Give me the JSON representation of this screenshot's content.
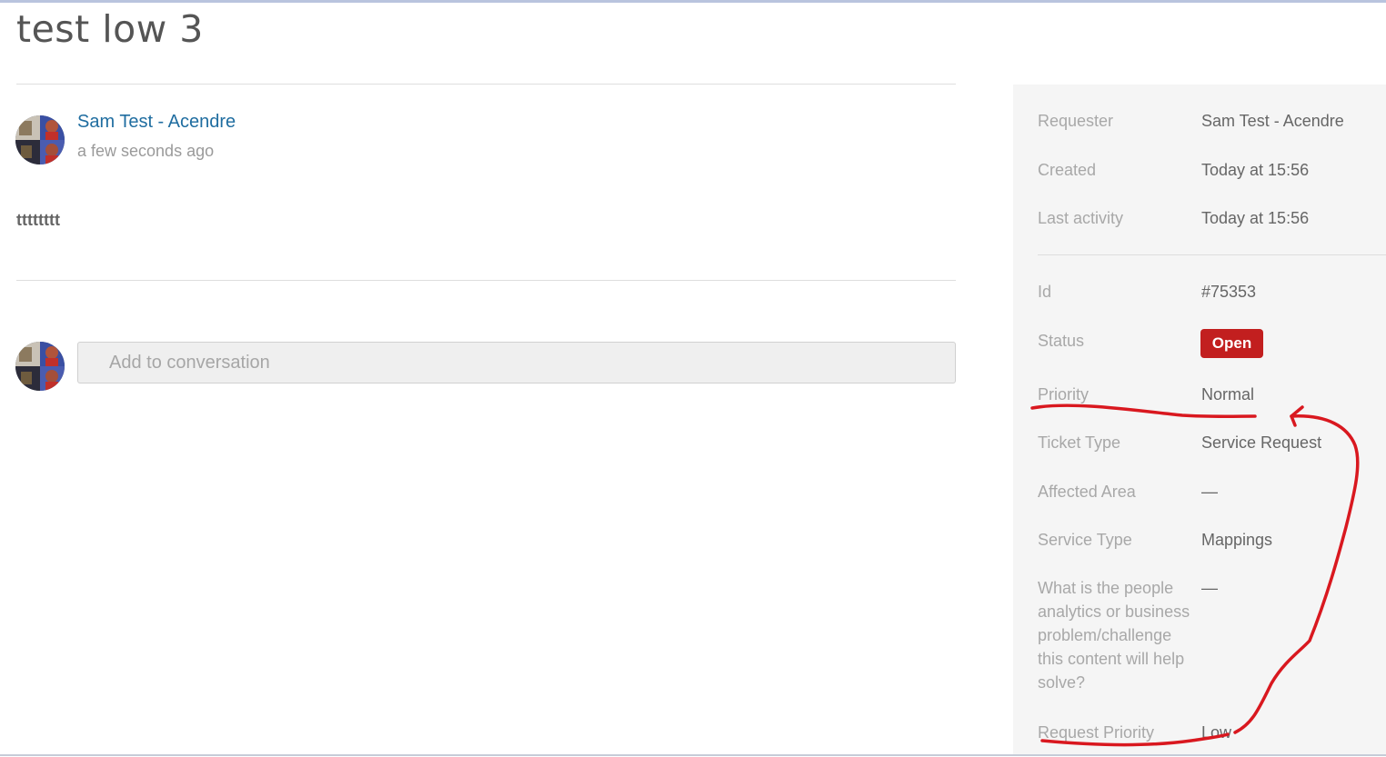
{
  "ticket": {
    "title": "test low 3"
  },
  "conversation": {
    "author": "Sam Test - Acendre",
    "timestamp": "a few seconds ago",
    "message": "tttttttt",
    "reply_placeholder": "Add to conversation"
  },
  "properties": {
    "requester": {
      "label": "Requester",
      "value": "Sam Test - Acendre"
    },
    "created": {
      "label": "Created",
      "value": "Today at 15:56"
    },
    "last_activity": {
      "label": "Last activity",
      "value": "Today at 15:56"
    },
    "id": {
      "label": "Id",
      "value": "#75353"
    },
    "status": {
      "label": "Status",
      "value": "Open",
      "color": "#c21f1f"
    },
    "priority": {
      "label": "Priority",
      "value": "Normal"
    },
    "ticket_type": {
      "label": "Ticket Type",
      "value": "Service Request"
    },
    "affected_area": {
      "label": "Affected Area",
      "value": "—"
    },
    "service_type": {
      "label": "Service Type",
      "value": "Mappings"
    },
    "analytics_question": {
      "label": "What is the people analytics or business problem/challenge this content will help solve?",
      "value": "—"
    },
    "request_priority": {
      "label": "Request Priority",
      "value": "Low"
    }
  },
  "annotation": {
    "color": "#d9181f"
  }
}
